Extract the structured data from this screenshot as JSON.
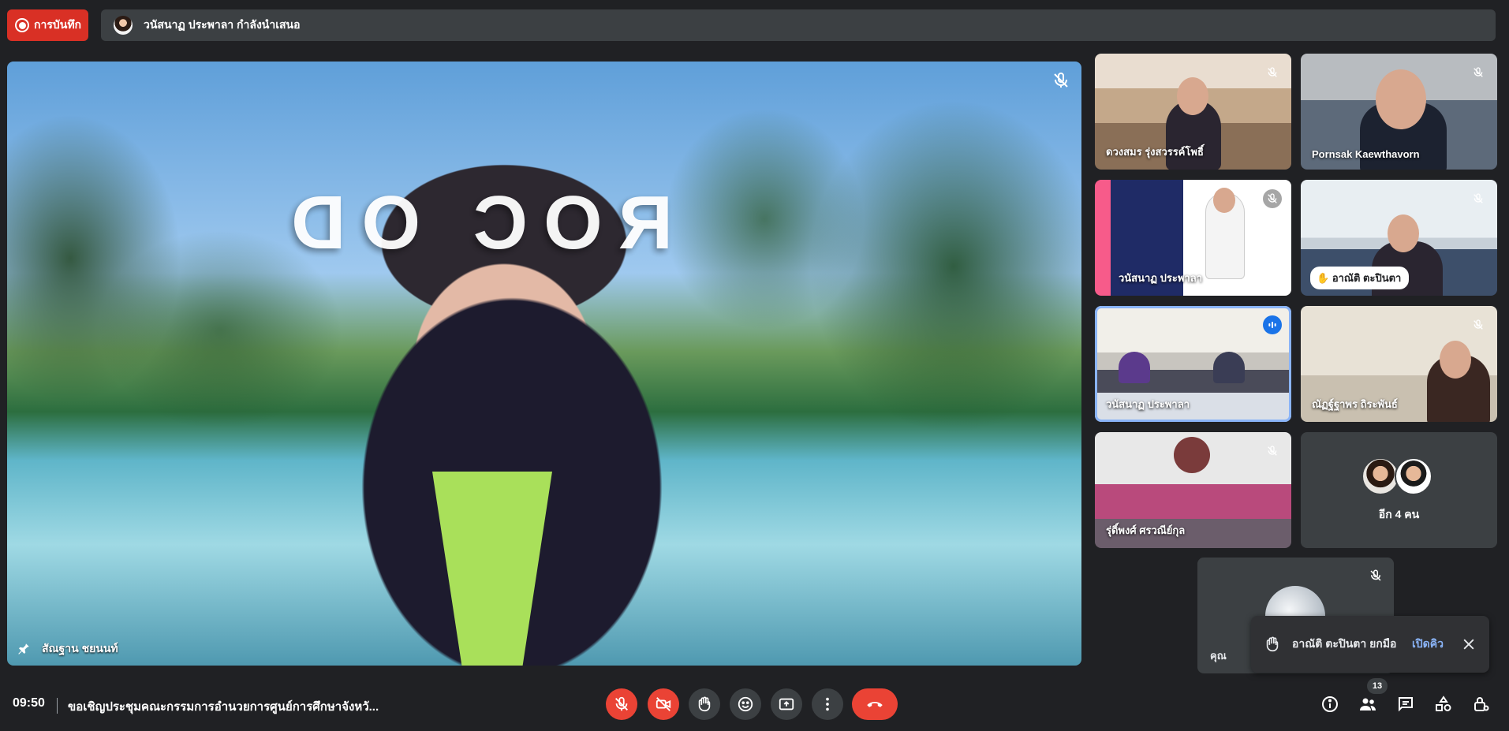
{
  "recording": {
    "label": "การบันทึก"
  },
  "presenting": {
    "text": "วนัสนาฏ ประพาลา กำลังนำเสนอ"
  },
  "main_speaker": {
    "name": "สัณฐาน ชยนนท์",
    "background_text": "ROC OD"
  },
  "tiles": [
    {
      "name": "ดวงสมร รุ่งสวรรค์โพธิ์",
      "muted": true
    },
    {
      "name": "Pornsak Kaewthavorn",
      "muted": true
    },
    {
      "name": "วนัสนาฏ ประพาลา",
      "muted": true,
      "presenting": true
    },
    {
      "name": "อาณัติ ตะปินตา",
      "muted": true,
      "hand_raised": true
    },
    {
      "name": "วนัสนาฏ ประพาลา",
      "muted": false,
      "speaking": true
    },
    {
      "name": "ณัฏฐ์ฐาพร ถิระพันธ์",
      "muted": true
    },
    {
      "name": "รุ่ดิ์พงศ์ ศรวณีย์กุล",
      "muted": true
    }
  ],
  "more": {
    "label": "อีก 4 คน"
  },
  "self": {
    "name": "คุณ"
  },
  "toast": {
    "text": "อาณัติ ตะปินตา ยกมือ",
    "action": "เปิดคิว"
  },
  "bottom": {
    "time": "09:50",
    "meeting_title": "ขอเชิญประชุมคณะกรรมการอำนวยการศูนย์การศึกษาจังหวั...",
    "participants_count": "13"
  },
  "colors": {
    "accent": "#8ab4f8",
    "danger": "#ea4335",
    "surface": "#3c4043",
    "background": "#202124"
  }
}
